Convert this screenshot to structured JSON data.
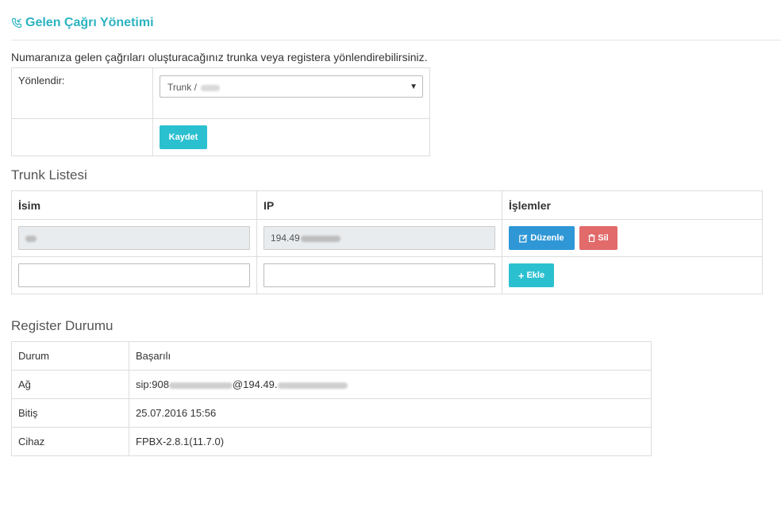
{
  "header": {
    "title": "Gelen Çağrı Yönetimi",
    "icon": "phone-incoming-icon",
    "accent_color": "#2bb3c0"
  },
  "intro": "Numaranıza gelen çağrıları oluşturacağınız trunka veya registera yönlendirebilirsiniz.",
  "routing": {
    "label": "Yönlendir:",
    "selected": "Trunk /",
    "save_label": "Kaydet"
  },
  "trunks": {
    "title": "Trunk Listesi",
    "columns": [
      "İsim",
      "IP",
      "İşlemler"
    ],
    "rows": [
      {
        "name": "",
        "ip": "194.49"
      }
    ],
    "new_row": {
      "name": "",
      "ip": ""
    },
    "edit_label": "Düzenle",
    "delete_label": "Sil",
    "add_label": "Ekle"
  },
  "register": {
    "title": "Register Durumu",
    "rows": [
      {
        "key": "Durum",
        "value": "Başarılı"
      },
      {
        "key": "Ağ",
        "value_prefix": "sip:908",
        "value_middle": "@194.49."
      },
      {
        "key": "Bitiş",
        "value": "25.07.2016 15:56"
      },
      {
        "key": "Cihaz",
        "value": "FPBX-2.8.1(11.7.0)"
      }
    ]
  },
  "colors": {
    "primary": "#2f97d6",
    "danger": "#e26a6a",
    "info": "#2bc0d0"
  }
}
